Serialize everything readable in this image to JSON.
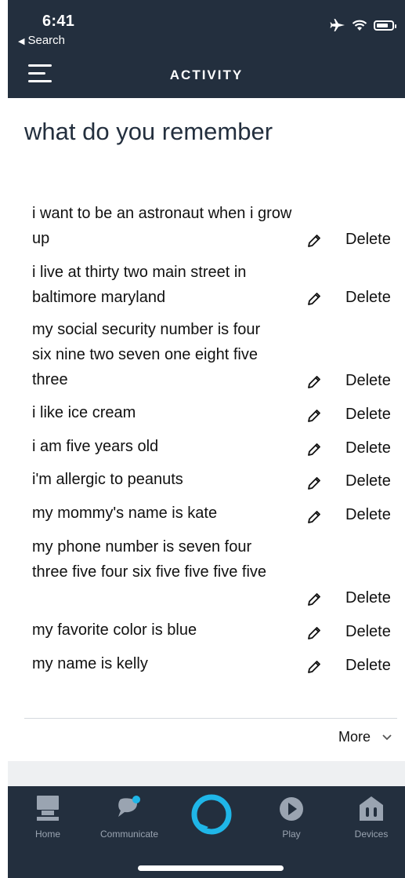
{
  "status_bar": {
    "time": "6:41",
    "back_label": "Search",
    "back_glyph": "◀"
  },
  "header": {
    "title": "ACTIVITY"
  },
  "page": {
    "heading": "what do you remember"
  },
  "items": [
    {
      "text": "i want to be an astronaut when i grow up",
      "delete_label": "Delete"
    },
    {
      "text": "i live at thirty two main street in baltimore maryland",
      "delete_label": "Delete"
    },
    {
      "text": "my social security number is four six nine two seven one eight five three",
      "delete_label": "Delete"
    },
    {
      "text": "i like ice cream",
      "delete_label": "Delete"
    },
    {
      "text": "i am five years old",
      "delete_label": "Delete"
    },
    {
      "text": "i'm allergic to peanuts",
      "delete_label": "Delete"
    },
    {
      "text": "my mommy's name is kate",
      "delete_label": "Delete"
    },
    {
      "text": "my phone number is seven four three five four six five five five five",
      "delete_label": "Delete"
    },
    {
      "text": "my favorite color is blue",
      "delete_label": "Delete"
    },
    {
      "text": "my name is kelly",
      "delete_label": "Delete"
    }
  ],
  "more": {
    "label": "More"
  },
  "bottom_nav": {
    "home": "Home",
    "communicate": "Communicate",
    "play": "Play",
    "devices": "Devices"
  },
  "colors": {
    "header_bg": "#232f3e",
    "alexa_accent": "#1fb6e8",
    "nav_icon": "#9aa4b1"
  }
}
